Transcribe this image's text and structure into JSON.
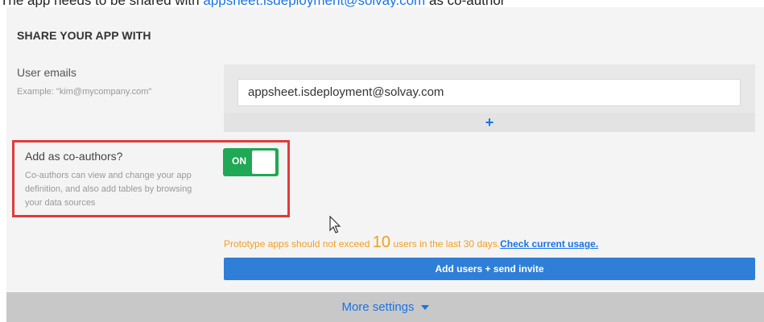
{
  "caption": {
    "prefix": "The app needs to be shared with ",
    "email_link": "appsheet.isdeployment@solvay.com",
    "suffix": " as co-author"
  },
  "share": {
    "title": "SHARE YOUR APP WITH",
    "user_emails_label": "User emails",
    "example_hint": "Example: \"kim@mycompany.com\"",
    "email_value": "appsheet.isdeployment@solvay.com",
    "add_symbol": "+"
  },
  "coauthor": {
    "label": "Add as co-authors?",
    "help": "Co-authors can view and change your app definition, and also add tables by browsing your data sources",
    "toggle_text": "ON",
    "toggle_state": "on"
  },
  "warning": {
    "prefix": "Prototype apps should not exceed ",
    "limit": "10",
    "suffix": " users in the last 30 days.",
    "usage_link": "Check current usage."
  },
  "actions": {
    "send_label": "Add users + send invite",
    "more_settings_label": "More settings"
  },
  "colors": {
    "accent": "#1a73e8",
    "toggle_on": "#1fa855",
    "warning": "#f0a020",
    "highlight": "#e03b3b",
    "button": "#2f7fd8"
  }
}
